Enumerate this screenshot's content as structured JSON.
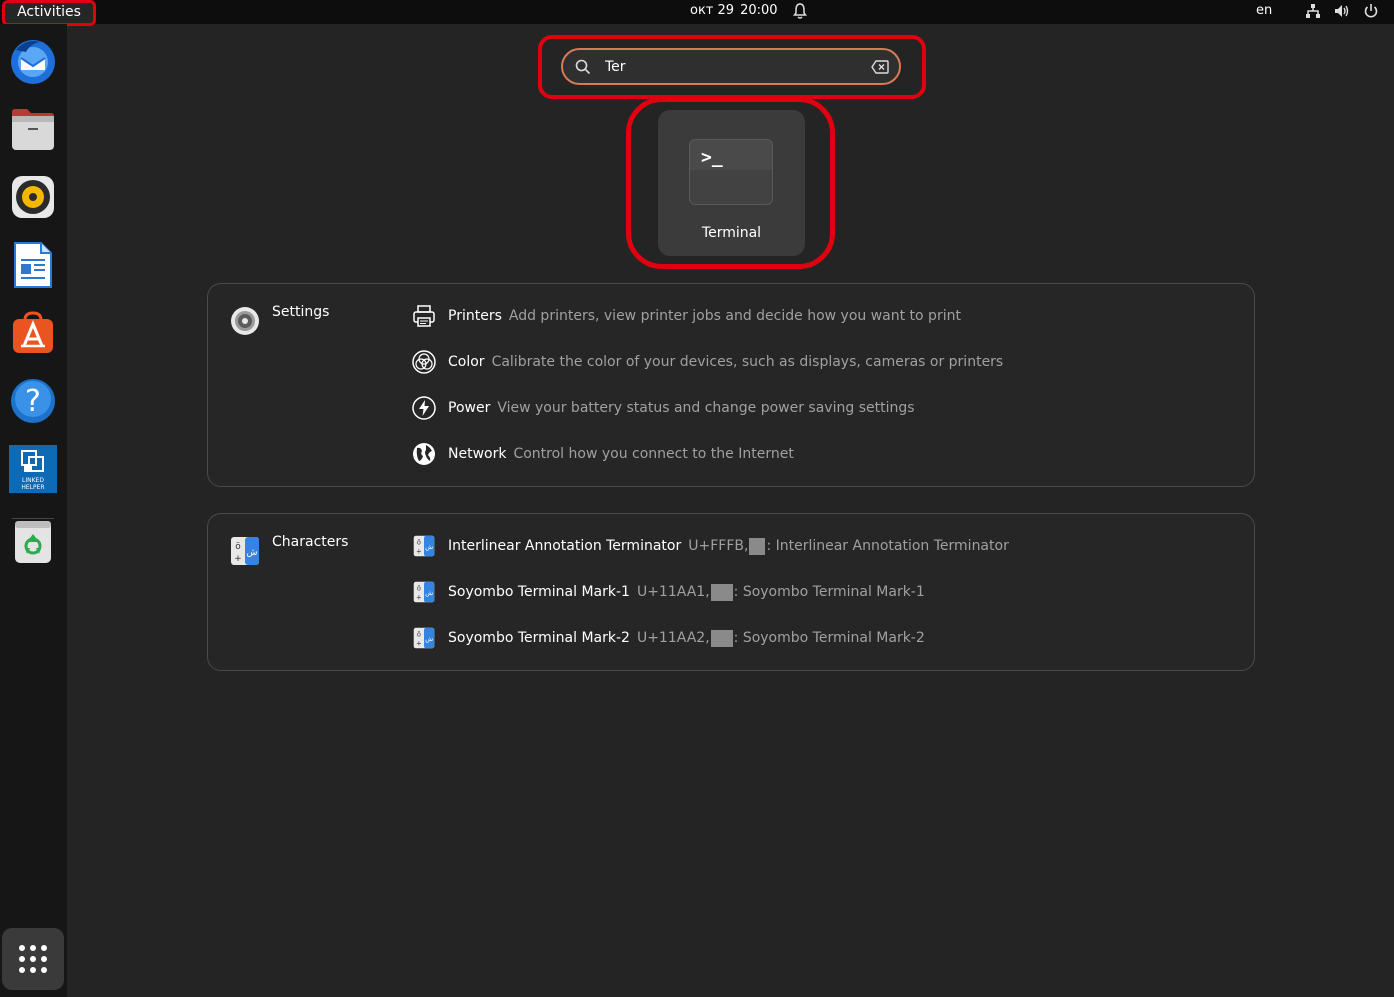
{
  "topbar": {
    "activities_label": "Activities",
    "date": "окт 29",
    "time": "20:00",
    "language": "en"
  },
  "dock": {
    "items": [
      {
        "name": "Thunderbird Mail",
        "icon": "thunderbird-icon"
      },
      {
        "name": "Files",
        "icon": "files-icon"
      },
      {
        "name": "Rhythmbox",
        "icon": "rhythmbox-icon"
      },
      {
        "name": "LibreOffice Writer",
        "icon": "writer-icon"
      },
      {
        "name": "Ubuntu Software",
        "icon": "software-center-icon"
      },
      {
        "name": "Help",
        "icon": "help-icon"
      },
      {
        "name": "Linked Helper",
        "icon": "linked-helper-icon",
        "label": "LINKED HELPER"
      },
      {
        "name": "Trash",
        "icon": "trash-icon"
      }
    ],
    "show_apps_icon": "grid-icon"
  },
  "search": {
    "value": "Ter"
  },
  "apps": [
    {
      "label": "Terminal",
      "icon": "terminal-icon",
      "prompt": ">_"
    }
  ],
  "settings_results": {
    "provider": "Settings",
    "items": [
      {
        "title": "Printers",
        "icon": "printer-icon",
        "desc": "Add printers, view printer jobs and decide how you want to print"
      },
      {
        "title": "Color",
        "icon": "color-icon",
        "desc": "Calibrate the color of your devices, such as displays, cameras or printers"
      },
      {
        "title": "Power",
        "icon": "power-icon",
        "desc": "View your battery status and change power saving settings"
      },
      {
        "title": "Network",
        "icon": "globe-icon",
        "desc": "Control how you connect to the Internet"
      }
    ]
  },
  "character_results": {
    "provider": "Characters",
    "items": [
      {
        "title": "Interlinear Annotation Terminator",
        "code": "U+FFFB,",
        "desc": ": Interlinear Annotation Terminator"
      },
      {
        "title": "Soyombo Terminal Mark-1",
        "code": "U+11AA1,",
        "desc": ": Soyombo Terminal Mark-1"
      },
      {
        "title": "Soyombo Terminal Mark-2",
        "code": "U+11AA2,",
        "desc": ": Soyombo Terminal Mark-2"
      }
    ]
  },
  "colors": {
    "highlight": "#e0000f",
    "focus": "#d87a56",
    "background": "#242424"
  }
}
